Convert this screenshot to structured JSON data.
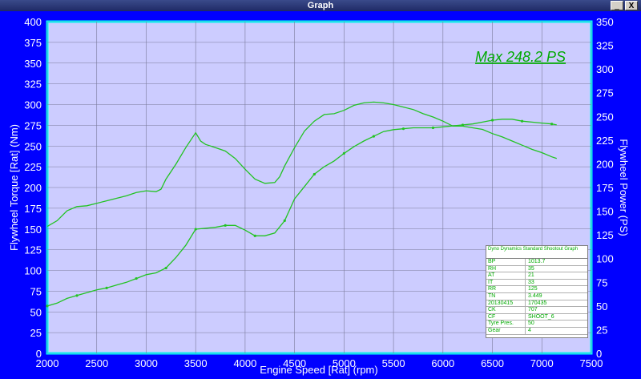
{
  "window": {
    "title": "Graph",
    "minimize_glyph": "_",
    "close_glyph": "X"
  },
  "chart_data": {
    "type": "line",
    "xlabel": "Engine Speed [Rat] (rpm)",
    "ylabel_left": "Flywheel Torque [Rat] (Nm)",
    "ylabel_right": "Flywheel Power (PS)",
    "xlim": [
      2000,
      7500
    ],
    "ylim_left": [
      0,
      400
    ],
    "ylim_right": [
      0,
      350
    ],
    "x_ticks": [
      "2000",
      "2500",
      "3000",
      "3500",
      "4000",
      "4500",
      "5000",
      "5500",
      "6000",
      "6500",
      "7000",
      "7500"
    ],
    "y_ticks_left": [
      "0",
      "25",
      "50",
      "75",
      "100",
      "125",
      "150",
      "175",
      "200",
      "225",
      "250",
      "275",
      "300",
      "325",
      "350",
      "375",
      "400"
    ],
    "y_ticks_right": [
      "0",
      "25",
      "50",
      "75",
      "100",
      "125",
      "150",
      "175",
      "200",
      "225",
      "250",
      "275",
      "300",
      "325",
      "350"
    ],
    "grid": true,
    "annotation": "Max 248.2 PS",
    "series": [
      {
        "axis": "left",
        "color": "#22c322",
        "points": [
          [
            2000,
            153
          ],
          [
            2100,
            160
          ],
          [
            2200,
            172
          ],
          [
            2300,
            177
          ],
          [
            2400,
            178
          ],
          [
            2500,
            181
          ],
          [
            2600,
            184
          ],
          [
            2700,
            187
          ],
          [
            2800,
            190
          ],
          [
            2900,
            194
          ],
          [
            3000,
            196
          ],
          [
            3100,
            195
          ],
          [
            3150,
            198
          ],
          [
            3200,
            210
          ],
          [
            3300,
            228
          ],
          [
            3400,
            248
          ],
          [
            3500,
            266
          ],
          [
            3550,
            256
          ],
          [
            3600,
            252
          ],
          [
            3700,
            248
          ],
          [
            3800,
            244
          ],
          [
            3900,
            235
          ],
          [
            4000,
            222
          ],
          [
            4100,
            210
          ],
          [
            4200,
            205
          ],
          [
            4300,
            206
          ],
          [
            4350,
            213
          ],
          [
            4400,
            226
          ],
          [
            4500,
            248
          ],
          [
            4600,
            268
          ],
          [
            4700,
            280
          ],
          [
            4800,
            288
          ],
          [
            4900,
            289
          ],
          [
            5000,
            293
          ],
          [
            5100,
            299
          ],
          [
            5200,
            302
          ],
          [
            5300,
            303
          ],
          [
            5400,
            302
          ],
          [
            5500,
            300
          ],
          [
            5600,
            297
          ],
          [
            5700,
            294
          ],
          [
            5800,
            289
          ],
          [
            5900,
            285
          ],
          [
            6000,
            280
          ],
          [
            6100,
            274
          ],
          [
            6200,
            274
          ],
          [
            6300,
            272
          ],
          [
            6400,
            270
          ],
          [
            6500,
            265
          ],
          [
            6600,
            261
          ],
          [
            6700,
            256
          ],
          [
            6800,
            251
          ],
          [
            6900,
            246
          ],
          [
            7000,
            242
          ],
          [
            7100,
            237
          ],
          [
            7150,
            235
          ]
        ]
      },
      {
        "axis": "right",
        "color": "#22c322",
        "points": [
          [
            2000,
            50
          ],
          [
            2100,
            53
          ],
          [
            2200,
            58
          ],
          [
            2300,
            61
          ],
          [
            2400,
            64
          ],
          [
            2500,
            67
          ],
          [
            2600,
            69
          ],
          [
            2700,
            72
          ],
          [
            2800,
            75
          ],
          [
            2900,
            79
          ],
          [
            3000,
            83
          ],
          [
            3100,
            85
          ],
          [
            3200,
            90
          ],
          [
            3300,
            101
          ],
          [
            3400,
            114
          ],
          [
            3500,
            131
          ],
          [
            3600,
            132
          ],
          [
            3700,
            133
          ],
          [
            3800,
            135
          ],
          [
            3900,
            135
          ],
          [
            4000,
            130
          ],
          [
            4100,
            124
          ],
          [
            4200,
            124
          ],
          [
            4300,
            127
          ],
          [
            4400,
            140
          ],
          [
            4500,
            163
          ],
          [
            4600,
            176
          ],
          [
            4700,
            189
          ],
          [
            4800,
            197
          ],
          [
            4900,
            203
          ],
          [
            5000,
            211
          ],
          [
            5100,
            218
          ],
          [
            5200,
            224
          ],
          [
            5300,
            229
          ],
          [
            5400,
            234
          ],
          [
            5500,
            236
          ],
          [
            5600,
            237
          ],
          [
            5700,
            238
          ],
          [
            5800,
            238
          ],
          [
            5900,
            238
          ],
          [
            6000,
            239
          ],
          [
            6100,
            240
          ],
          [
            6200,
            241
          ],
          [
            6300,
            242
          ],
          [
            6400,
            244
          ],
          [
            6500,
            246
          ],
          [
            6600,
            247
          ],
          [
            6700,
            247
          ],
          [
            6800,
            245
          ],
          [
            6900,
            244
          ],
          [
            7000,
            243
          ],
          [
            7100,
            242
          ],
          [
            7150,
            241
          ]
        ]
      }
    ]
  },
  "info_table": {
    "header": "Dyno Dynamics Standard Shootout Graph",
    "rows": [
      {
        "k": "BP",
        "v": "1013.7"
      },
      {
        "k": "RH",
        "v": "35"
      },
      {
        "k": "AT",
        "v": "21"
      },
      {
        "k": "IT",
        "v": "33"
      },
      {
        "k": "RR",
        "v": "125"
      },
      {
        "k": "TN",
        "v": "3.449"
      },
      {
        "k": "20130415",
        "v": "170435"
      },
      {
        "k": "CK",
        "v": "707"
      },
      {
        "k": "CF",
        "v": "SHOOT_6"
      },
      {
        "k": "Tyre Pres.",
        "v": "50"
      },
      {
        "k": "Gear",
        "v": "4"
      }
    ]
  }
}
